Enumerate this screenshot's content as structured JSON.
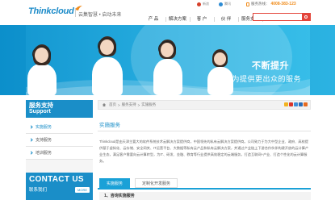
{
  "brand": {
    "logo_text": "Thinkcloud",
    "slogan": "云集智慧 • 启动未来"
  },
  "header": {
    "top_links": [
      {
        "icon": "weibo-icon",
        "label": "新浪"
      },
      {
        "icon": "qq-icon",
        "label": "腾讯"
      }
    ],
    "hotline_label": "服务热线：",
    "hotline_number": "4008-383-123",
    "nav": [
      "产 品",
      "解决方案",
      "客 户",
      "伙 伴",
      "服务支持",
      "关于我们"
    ],
    "search_placeholder": ""
  },
  "banner": {
    "title": "不断提升",
    "subtitle": "只为提供更出众的服务"
  },
  "sidebar": {
    "title_cn": "服务支持",
    "title_en": "Support",
    "items": [
      {
        "label": "实施服务",
        "active": true
      },
      {
        "label": "支持服务",
        "active": false
      },
      {
        "label": "培训服务",
        "active": false
      }
    ],
    "contact_title": "CONTACT US",
    "contact_label": "联系我们",
    "contact_more": "MORE"
  },
  "main": {
    "breadcrumb": [
      "首页",
      "服务支持",
      "实施服务"
    ],
    "page_title": "实施服务",
    "content": "Thinkcloud是由天津主要大的软件系统技术云解决方案提供商，中国领先的私有云解决方案提供商。公司致力于为大中型企业、政府、高校提供基于虚拟化、云存储、安全网关、IT运营平台、大数据等私有云产品和私有云解决方案，并通过产业链上下游合作伙伴构建开放的云计算产业生态，满足客户需要向云计算转型，为IT、研发、金融、教育等行业提供高效稳定的云端服务，打造互联网+产业、打造个性化的云计算服务。",
    "tabs": [
      {
        "label": "实施服务",
        "active": true
      },
      {
        "label": "定制化开发服务",
        "active": false
      }
    ],
    "section_head": "1、咨询实施服务"
  },
  "colors": {
    "brand_blue": "#1a8ec8",
    "accent_red": "#e3443a",
    "hotline_orange": "#f08b1a"
  }
}
